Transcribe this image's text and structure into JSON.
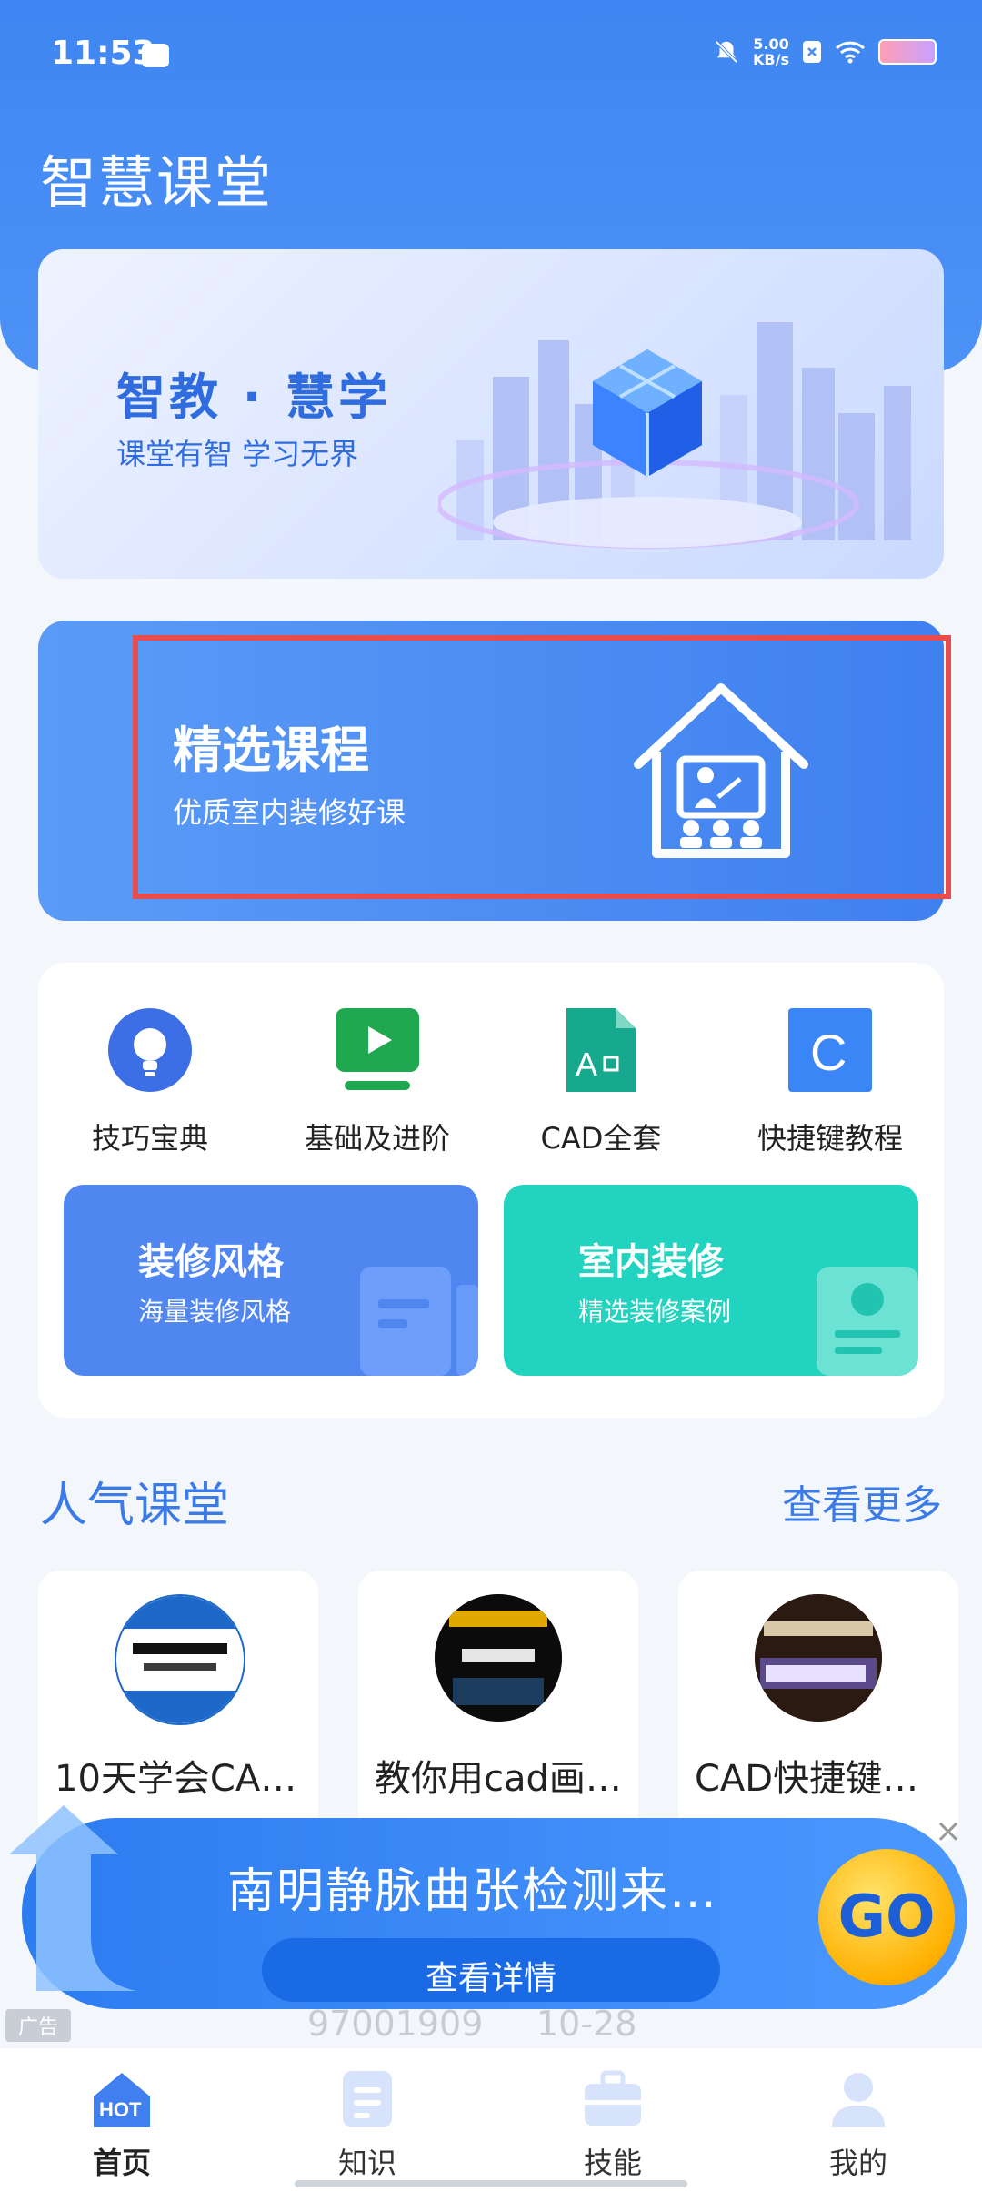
{
  "status_bar": {
    "time": "11:53",
    "speed_value": "5.00",
    "speed_unit": "KB/s"
  },
  "app": {
    "title": "智慧课堂"
  },
  "banner": {
    "title": "智教 · 慧学",
    "subtitle": "课堂有智 学习无界"
  },
  "featured": {
    "title": "精选课程",
    "subtitle": "优质室内装修好课",
    "highlight_color": "#e84c4c"
  },
  "tools": [
    {
      "label": "技巧宝典",
      "icon": "bulb-icon"
    },
    {
      "label": "基础及进阶",
      "icon": "video-play-icon"
    },
    {
      "label": "CAD全套",
      "icon": "cad-file-icon"
    },
    {
      "label": "快捷键教程",
      "icon": "letter-c-icon"
    }
  ],
  "promos": [
    {
      "title": "装修风格",
      "subtitle": "海量装修风格",
      "color": "#4f86f0"
    },
    {
      "title": "室内装修",
      "subtitle": "精选装修案例",
      "color": "#22d3c0"
    }
  ],
  "popular": {
    "title": "人气课堂",
    "more_label": "查看更多",
    "courses": [
      {
        "title": "10天学会CA…"
      },
      {
        "title": "教你用cad画…"
      },
      {
        "title": "CAD快捷键…"
      }
    ]
  },
  "ad": {
    "title": "南明静脉曲张检测来…",
    "button_label": "查看详情",
    "go_label": "GO",
    "close_label": "×",
    "ad_tag": "广告",
    "ghost_num": "97001909",
    "ghost_date": "10-28"
  },
  "nav": [
    {
      "label": "首页",
      "icon": "home-hot-icon",
      "active": true
    },
    {
      "label": "知识",
      "icon": "document-icon",
      "active": false
    },
    {
      "label": "技能",
      "icon": "briefcase-icon",
      "active": false
    },
    {
      "label": "我的",
      "icon": "user-icon",
      "active": false
    }
  ]
}
